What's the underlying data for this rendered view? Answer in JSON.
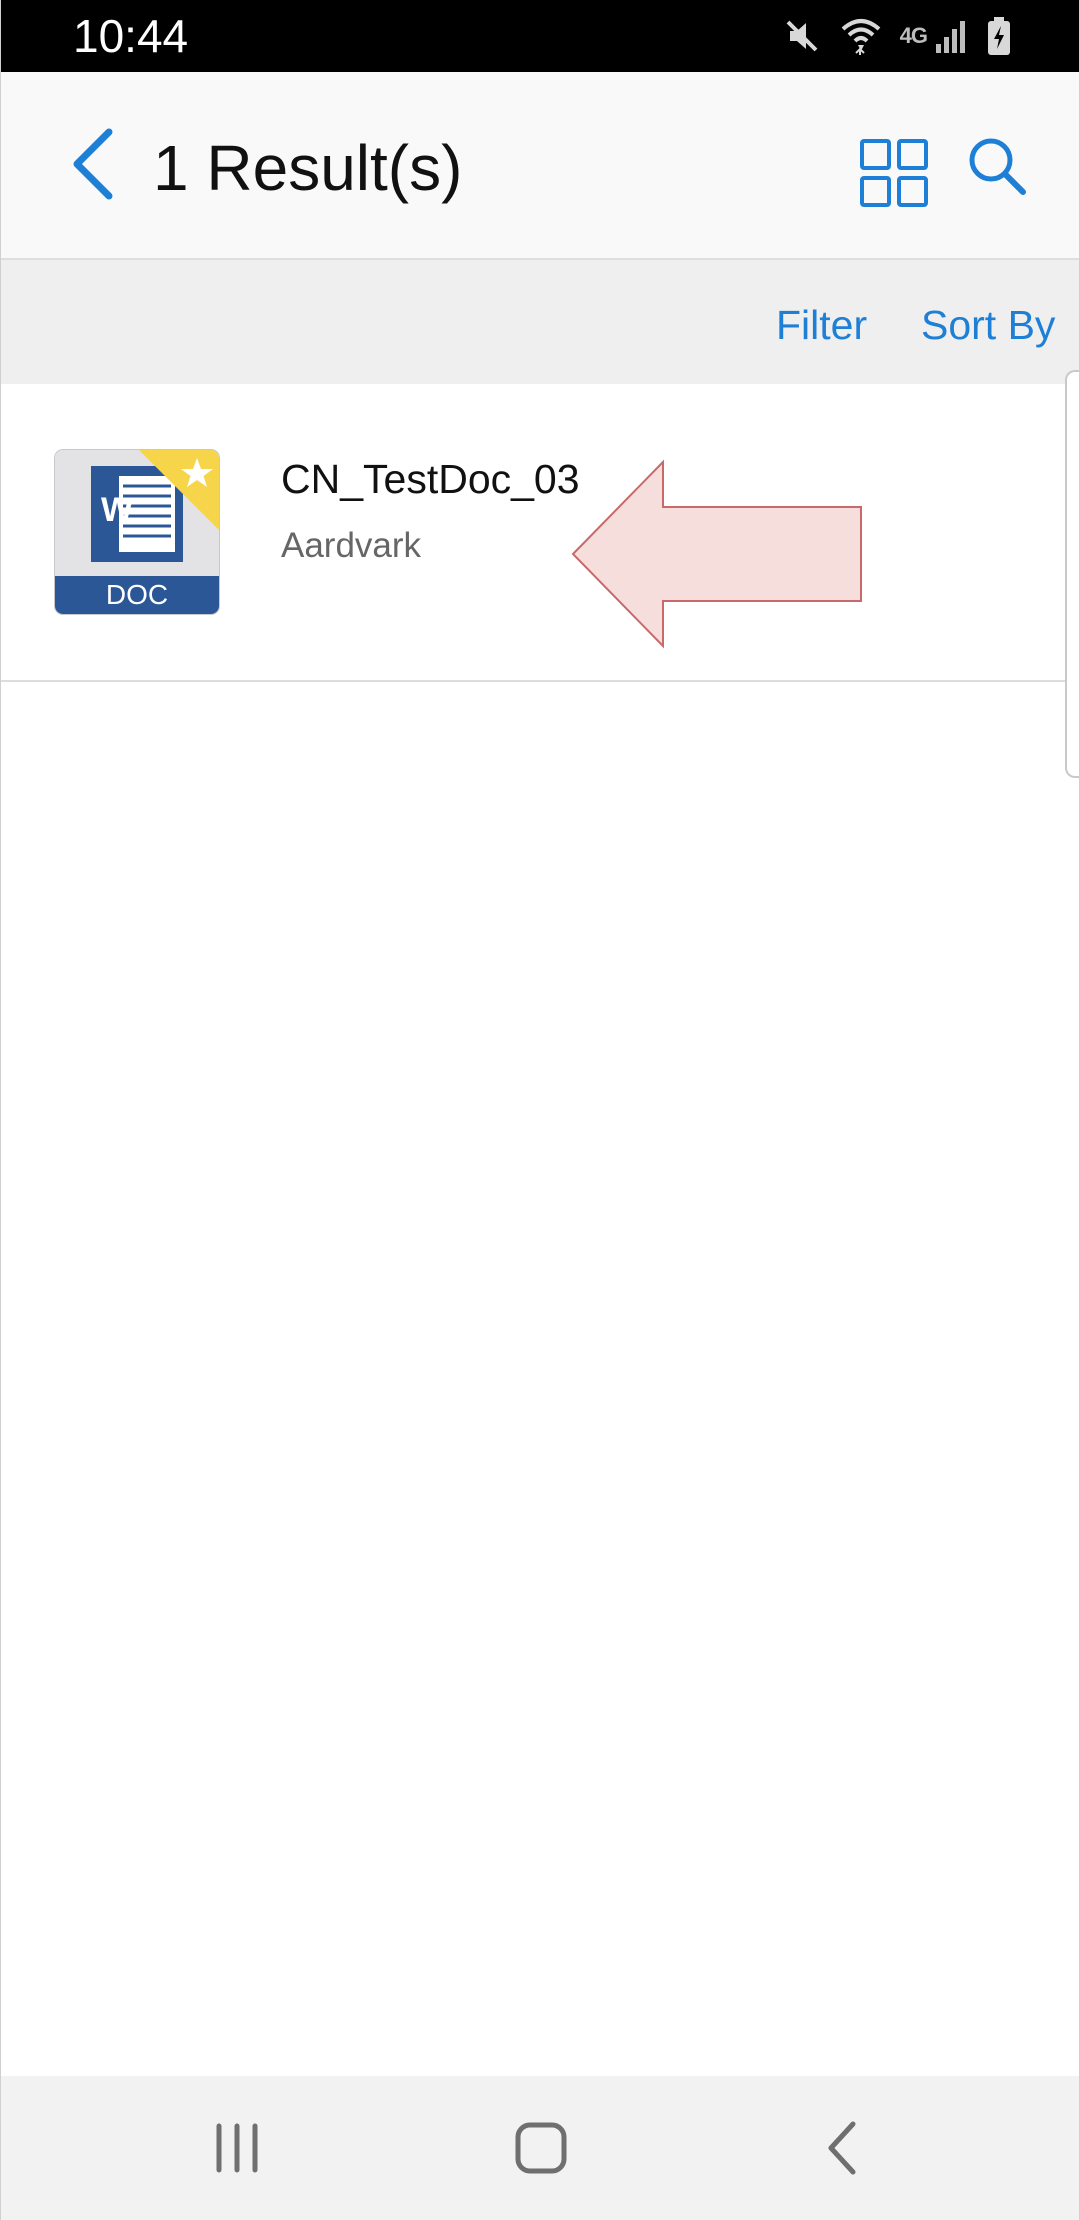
{
  "status_bar": {
    "time": "10:44",
    "network_label": "4G",
    "icons": [
      "mute-icon",
      "wifi-icon",
      "signal-icon",
      "battery-charging-icon"
    ]
  },
  "app_bar": {
    "title": "1 Result(s)",
    "icons": [
      "back-arrow-icon",
      "grid-view-icon",
      "search-icon"
    ]
  },
  "filter_bar": {
    "filter_label": "Filter",
    "sort_label": "Sort By"
  },
  "results": [
    {
      "name": "CN_TestDoc_03",
      "owner": "Aardvark",
      "type_label": "DOC",
      "type_letter": "W",
      "starred": true
    }
  ],
  "colors": {
    "accent": "#1e7fd6",
    "doc_blue": "#2b5797",
    "star_yellow": "#f7d54a",
    "annotation_fill": "#f6dedd",
    "annotation_stroke": "#c96a6a"
  },
  "nav_bar": {
    "icons": [
      "recents-icon",
      "home-icon",
      "nav-back-icon"
    ]
  }
}
